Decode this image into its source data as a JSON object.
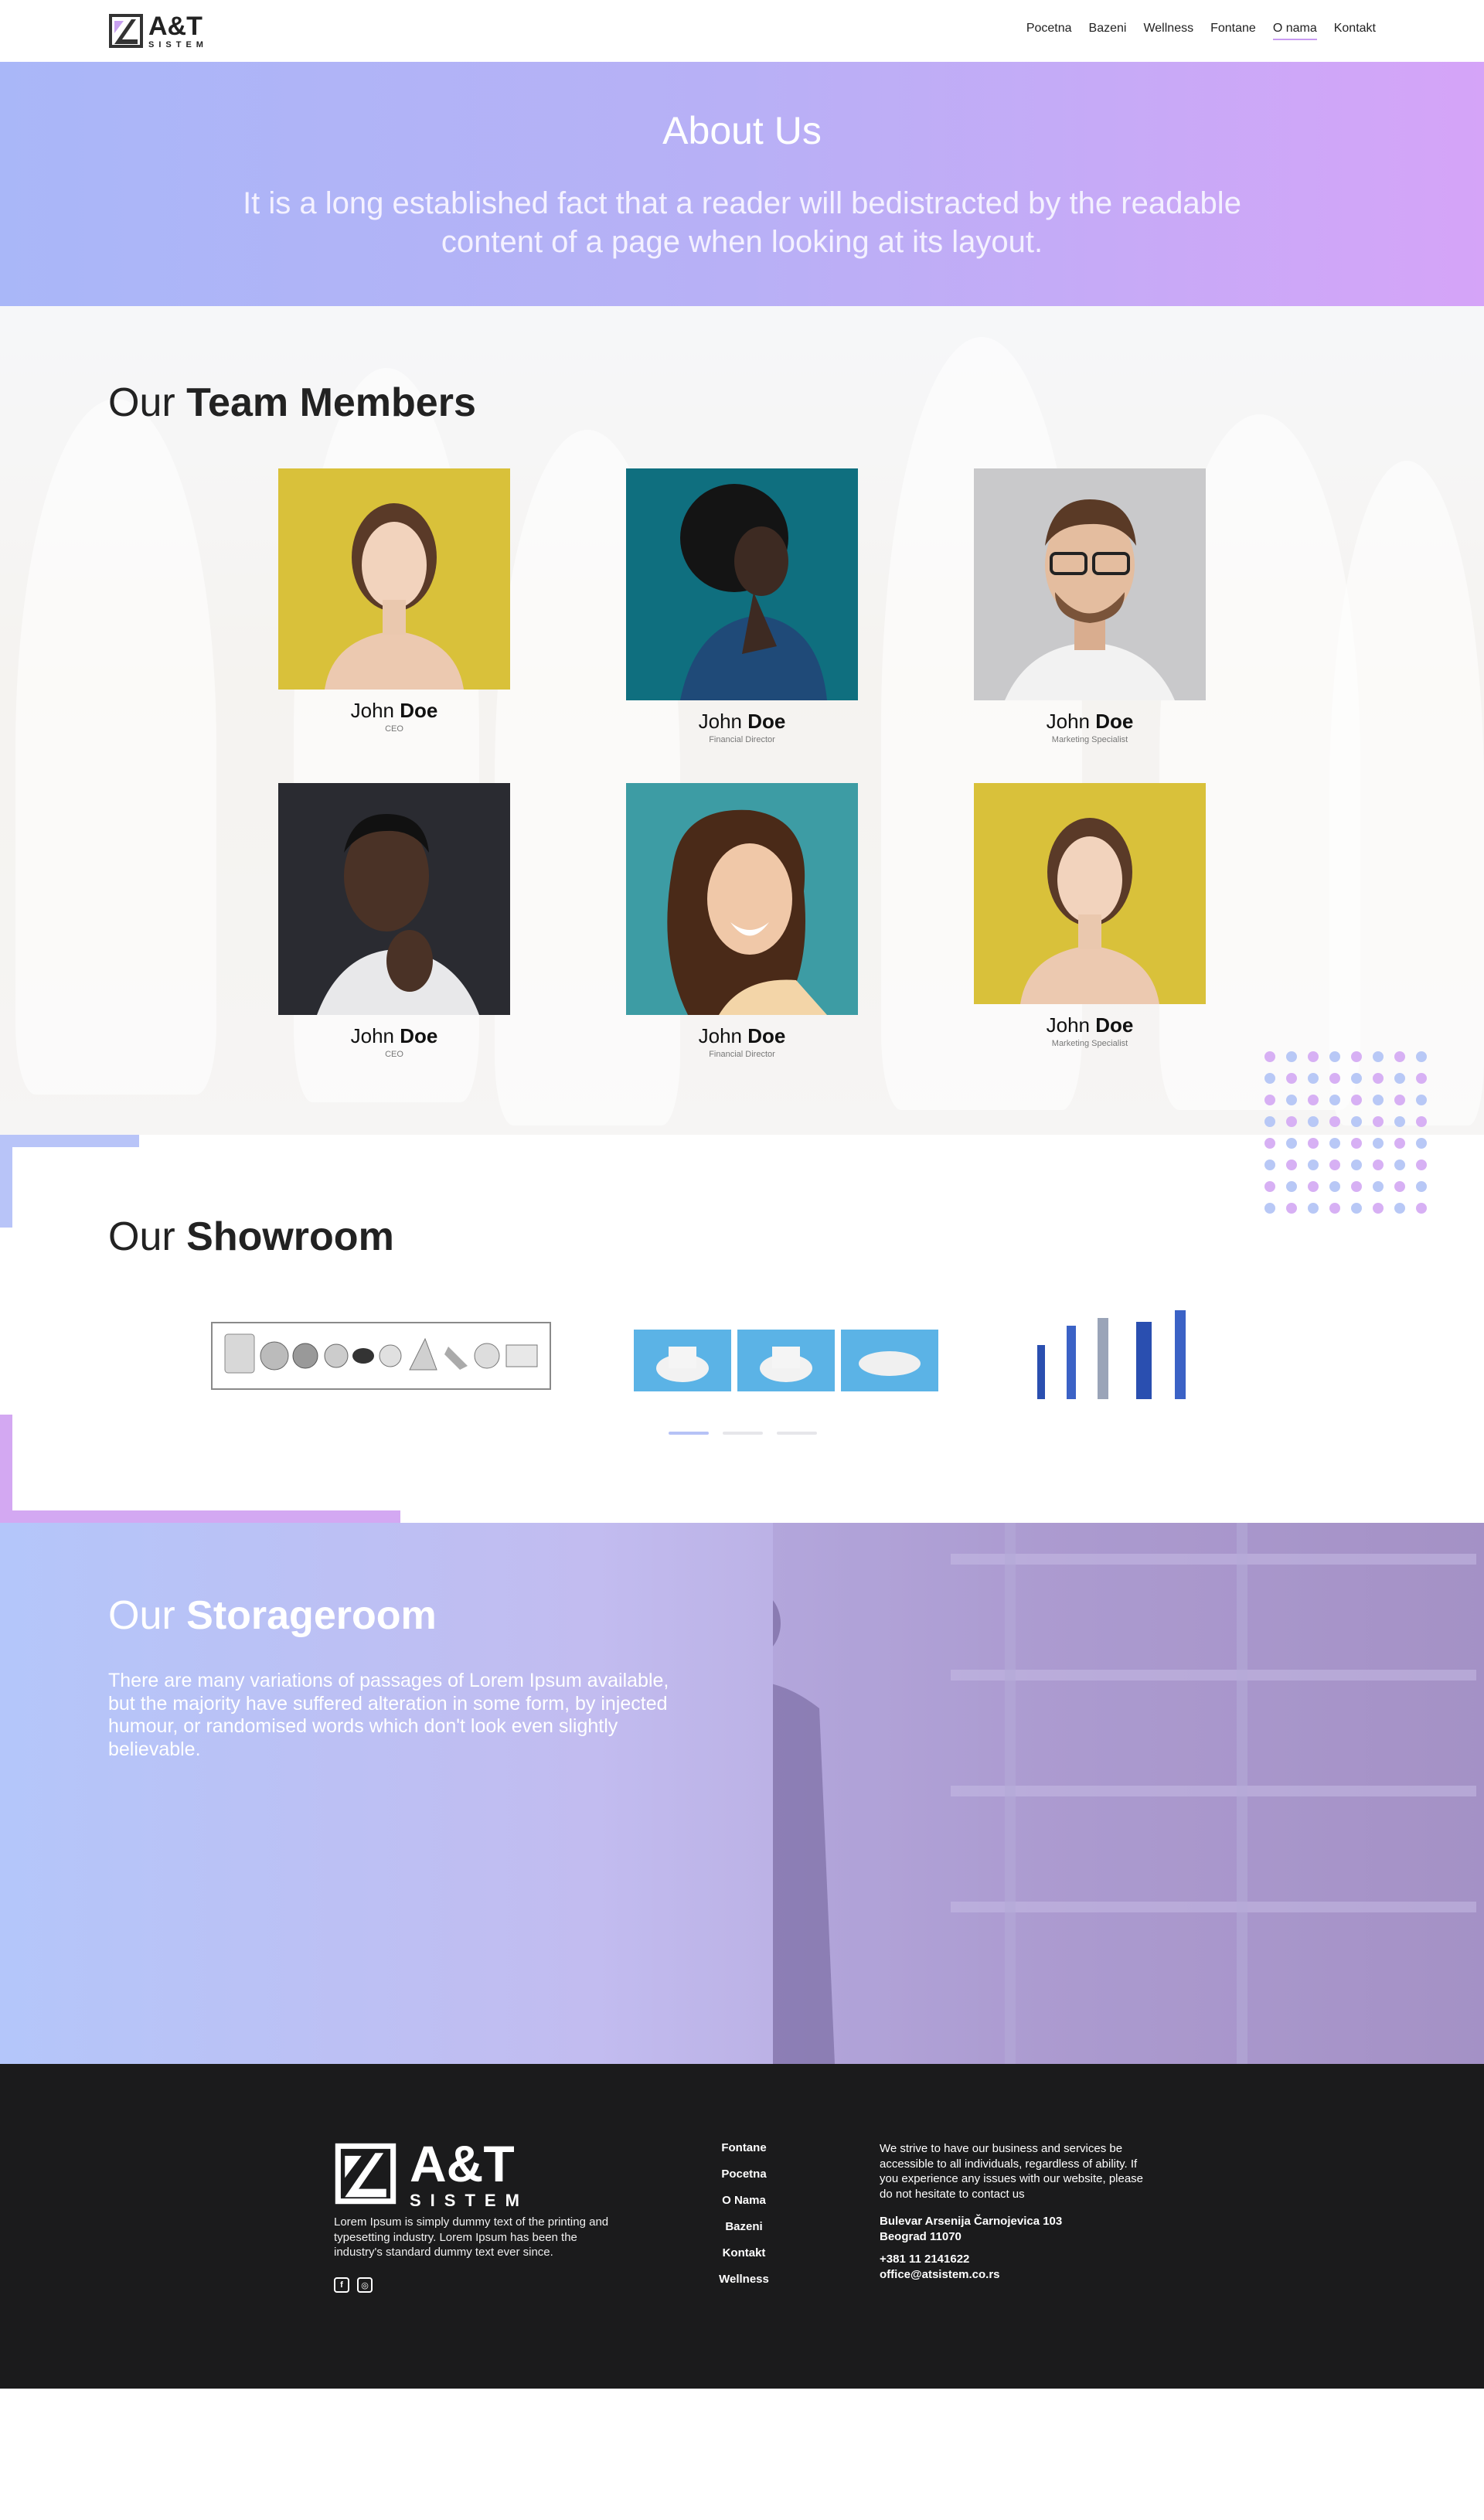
{
  "header": {
    "logo": {
      "name": "A&T",
      "sub": "SISTEM"
    },
    "nav": [
      {
        "label": "Pocetna",
        "active": false
      },
      {
        "label": "Bazeni",
        "active": false
      },
      {
        "label": "Wellness",
        "active": false
      },
      {
        "label": "Fontane",
        "active": false
      },
      {
        "label": "O nama",
        "active": true
      },
      {
        "label": "Kontakt",
        "active": false
      }
    ]
  },
  "hero": {
    "title": "About Us",
    "subtitle": "It is a long established fact that a reader will bedistracted by the readable content of a page when looking at its layout."
  },
  "team": {
    "title_light": "Our",
    "title_bold": "Team Members",
    "members": [
      {
        "first": "John",
        "last": "Doe",
        "role": "CEO",
        "photo_bg": "#d8c13a",
        "skin": "#f1d2bd"
      },
      {
        "first": "John",
        "last": "Doe",
        "role": "Financial Director",
        "photo_bg": "#0f6f7f",
        "skin": "#3d2a22"
      },
      {
        "first": "John",
        "last": "Doe",
        "role": "Marketing Specialist",
        "photo_bg": "#c9c9cb",
        "skin": "#e4bd9f"
      },
      {
        "first": "John",
        "last": "Doe",
        "role": "CEO",
        "photo_bg": "#2a2b31",
        "skin": "#4a3226"
      },
      {
        "first": "John",
        "last": "Doe",
        "role": "Financial Director",
        "photo_bg": "#3d9ca4",
        "skin": "#f0c8a8"
      },
      {
        "first": "John",
        "last": "Doe",
        "role": "Marketing Specialist",
        "photo_bg": "#d8c13a",
        "skin": "#f1d2bd"
      }
    ]
  },
  "showroom": {
    "title_light": "Our",
    "title_bold": "Showroom",
    "slides": 3,
    "active_slide": 0
  },
  "storage": {
    "title_light": "Our",
    "title_bold": "Storageroom",
    "text": "There are many variations of passages of Lorem Ipsum available, but the majority have suffered alteration in some form, by injected humour, or randomised words which don't look even slightly believable."
  },
  "footer": {
    "logo": {
      "name": "A&T",
      "sub": "SISTEM"
    },
    "description": "Lorem Ipsum is simply dummy text of the printing and typesetting industry. Lorem Ipsum has been the industry's standard dummy text ever since.",
    "socials": [
      {
        "icon": "facebook-icon",
        "glyph": "f"
      },
      {
        "icon": "instagram-icon",
        "glyph": "◎"
      }
    ],
    "links": [
      "Fontane",
      "Pocetna",
      "O Nama",
      "Bazeni",
      "Kontakt",
      "Wellness"
    ],
    "contact_text": "We strive to have our business and services be accessible to all individuals, regardless of ability. If you experience any issues with our website, please do not hesitate to contact us",
    "address_line1": "Bulevar Arsenija Čarnojevica 103",
    "address_line2": "Beograd 11070",
    "phone": "+381 11 2141622",
    "email": "office@atsistem.co.rs"
  },
  "colors": {
    "accent_blue": "#b8c4f8",
    "accent_pink": "#d3a8f2",
    "footer_bg": "#1b1b1c"
  }
}
